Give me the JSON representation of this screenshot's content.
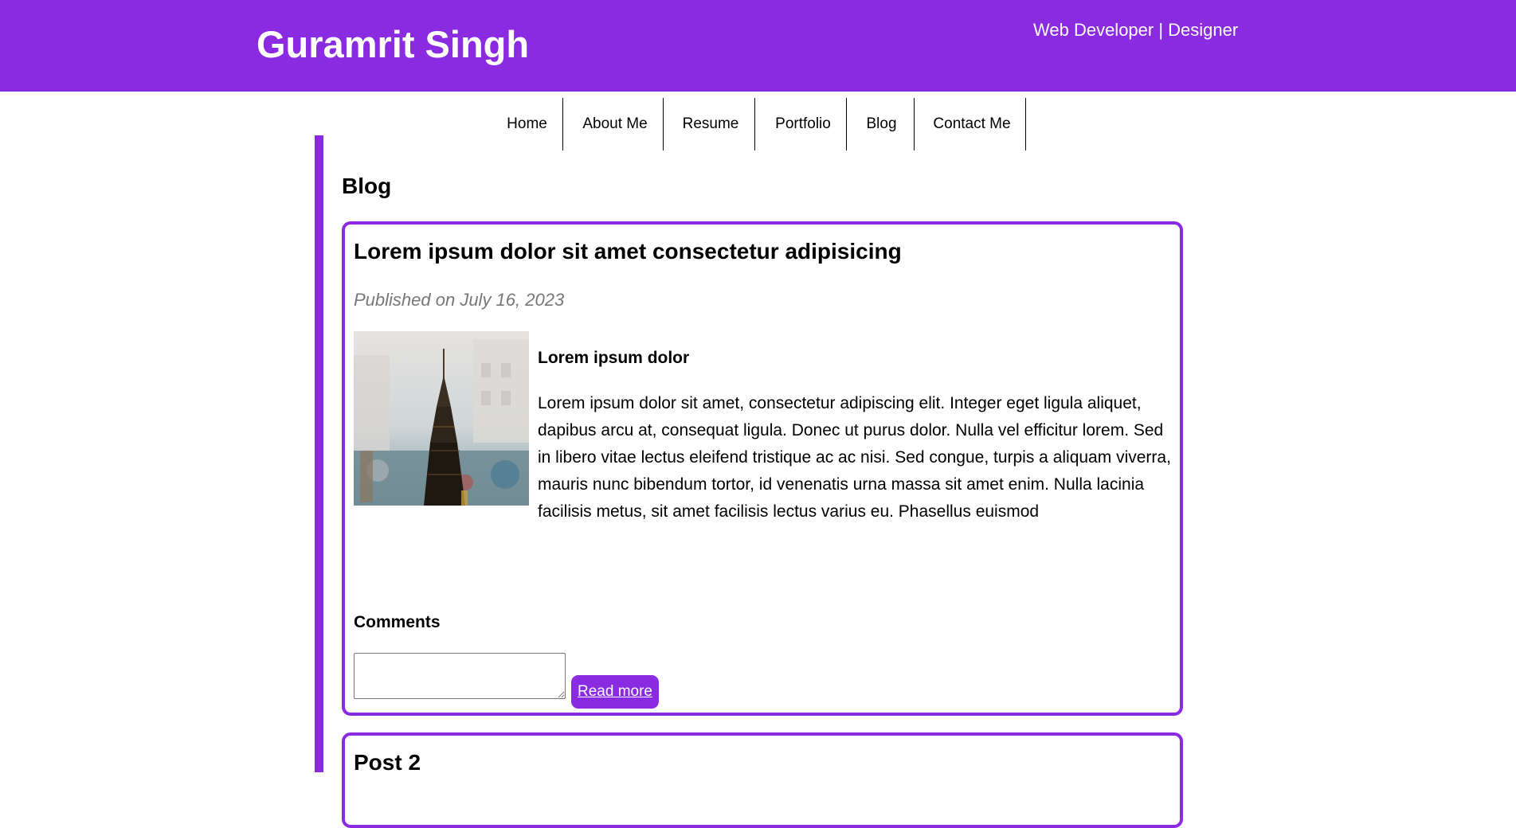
{
  "header": {
    "title": "Guramrit Singh",
    "tagline": "Web Developer | Designer"
  },
  "nav": {
    "items": [
      {
        "label": "Home"
      },
      {
        "label": "About Me"
      },
      {
        "label": "Resume"
      },
      {
        "label": "Portfolio"
      },
      {
        "label": "Blog"
      },
      {
        "label": "Contact Me"
      }
    ]
  },
  "main": {
    "heading": "Blog",
    "posts": [
      {
        "title": "Lorem ipsum dolor sit amet consectetur adipisicing",
        "date": "Published on July 16, 2023",
        "image_icon": "city-tower-photo",
        "subheading": "Lorem ipsum dolor",
        "body": "Lorem ipsum dolor sit amet, consectetur adipiscing elit. Integer eget ligula aliquet, dapibus arcu at, consequat ligula. Donec ut purus dolor. Nulla vel efficitur lorem. Sed in libero vitae lectus eleifend tristique ac ac nisi. Sed congue, turpis a aliquam viverra, mauris nunc bibendum tortor, id venenatis urna massa sit amet enim. Nulla lacinia facilisis metus, sit amet facilisis lectus varius eu. Phasellus euismod",
        "comments_label": "Comments",
        "comment_value": "",
        "read_more_label": "Read more"
      },
      {
        "title": "Post 2"
      }
    ]
  },
  "colors": {
    "accent": "#8a2be2",
    "date_text": "#777777"
  }
}
